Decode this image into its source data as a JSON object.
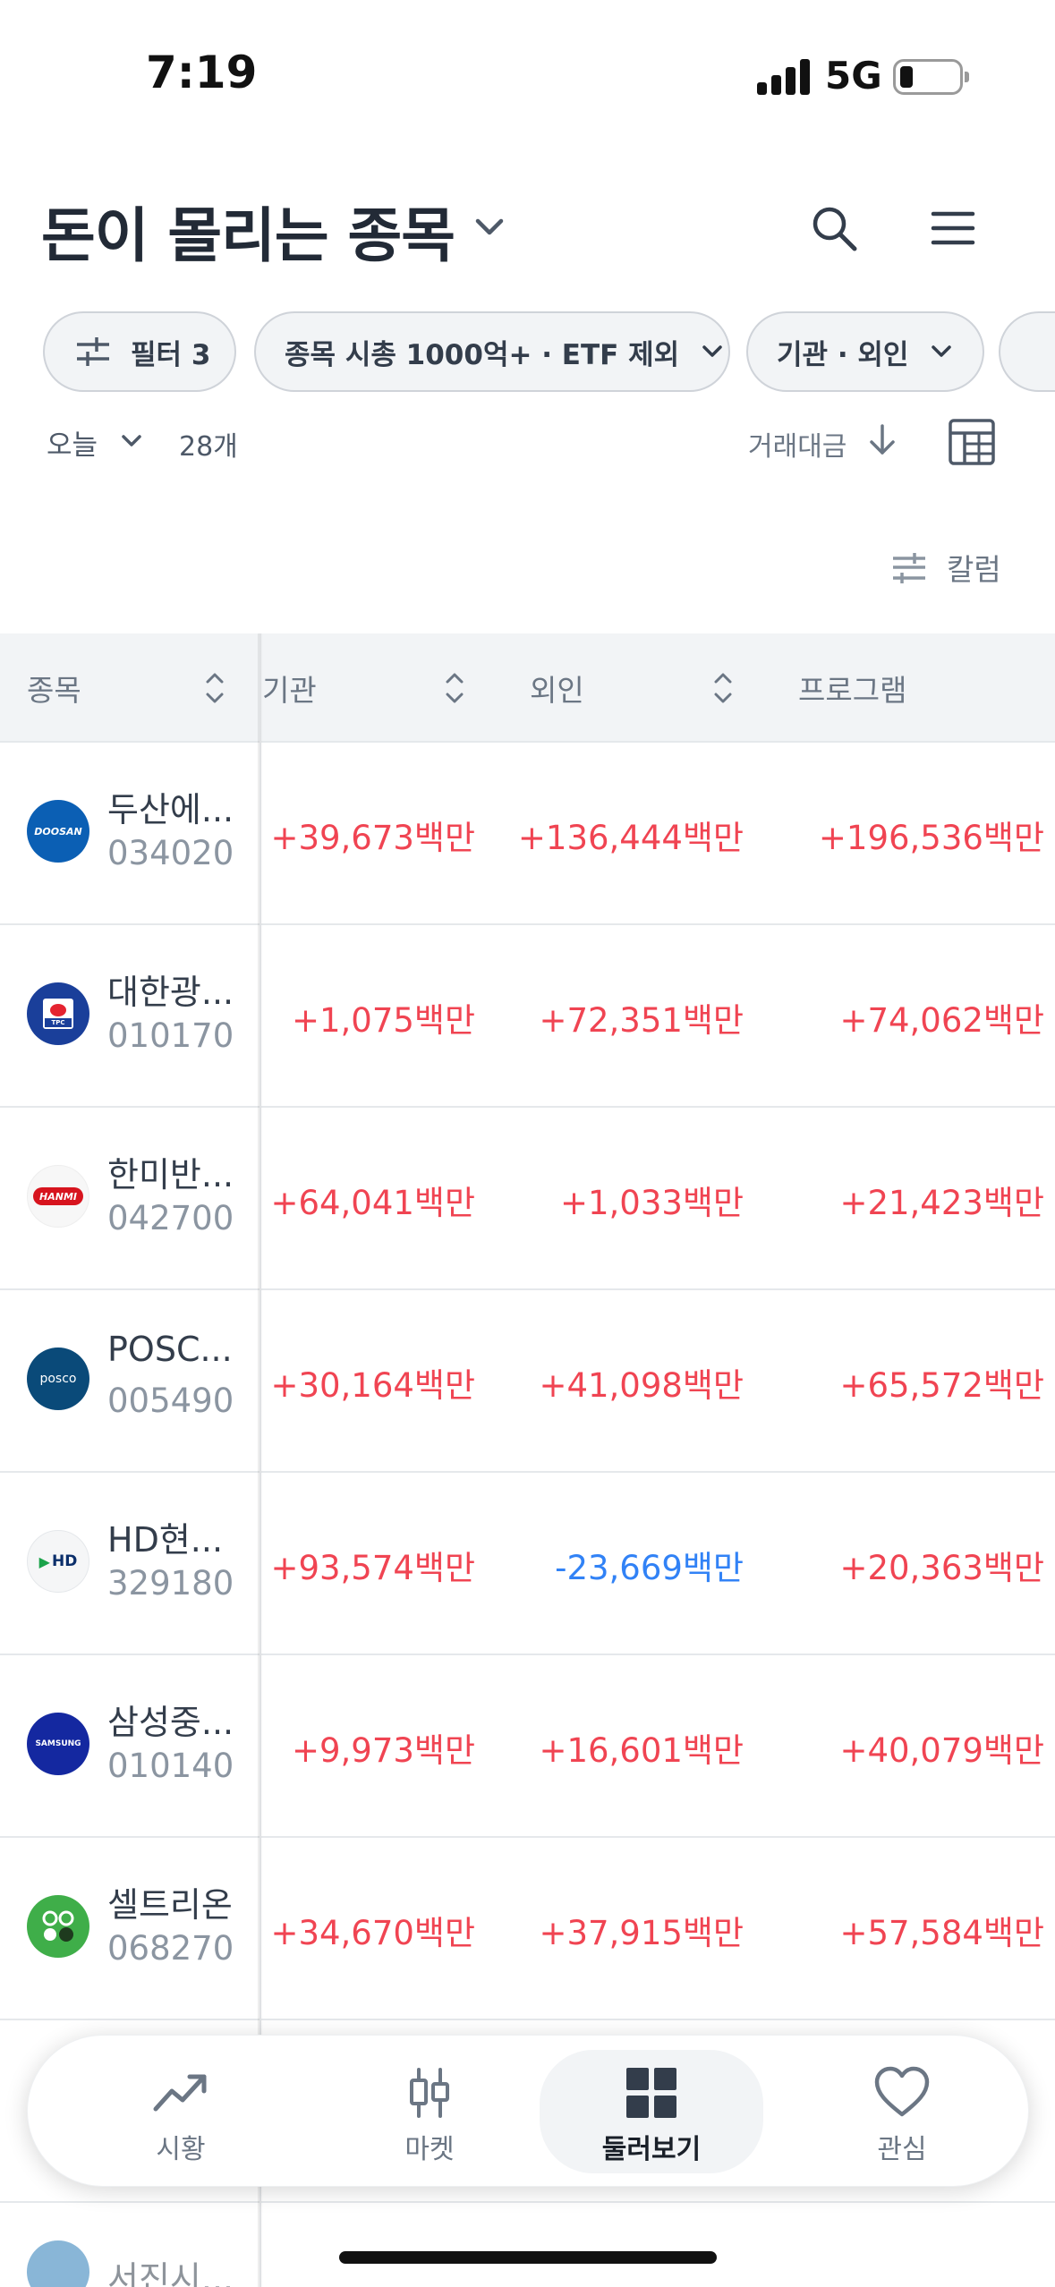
{
  "status": {
    "time": "7:19",
    "network": "5G"
  },
  "header": {
    "title": "돈이 몰리는 종목"
  },
  "filters": {
    "filter_chip": "필터 3",
    "market_chip": "종목 시총 1000억+ · ETF 제외",
    "investor_chip": "기관 · 외인"
  },
  "list": {
    "period": "오늘",
    "count": "28개",
    "sort": "거래대금",
    "column_button": "칼럼"
  },
  "table": {
    "headers": {
      "stock": "종목",
      "institution": "기관",
      "foreign": "외인",
      "program": "프로그램"
    },
    "rows": [
      {
        "name": "두산에...",
        "code": "034020",
        "logo": "DOOSAN",
        "inst": "+39,673백만",
        "foreign": "+136,444백만",
        "program": "+196,536백만",
        "color": "#0b5fb4"
      },
      {
        "name": "대한광...",
        "code": "010170",
        "logo": "TPC",
        "inst": "+1,075백만",
        "foreign": "+72,351백만",
        "program": "+74,062백만",
        "color": "#1a3f9a"
      },
      {
        "name": "한미반...",
        "code": "042700",
        "logo": "HANMI",
        "inst": "+64,041백만",
        "foreign": "+1,033백만",
        "program": "+21,423백만",
        "color": "#f7f7f7"
      },
      {
        "name": "POSC...",
        "code": "005490",
        "logo": "posco",
        "inst": "+30,164백만",
        "foreign": "+41,098백만",
        "program": "+65,572백만",
        "color": "#0a4a79"
      },
      {
        "name": "HD현...",
        "code": "329180",
        "logo": "HD",
        "inst": "+93,574백만",
        "foreign": "-23,669백만",
        "program": "+20,363백만",
        "color": "#f5f6f7"
      },
      {
        "name": "삼성중...",
        "code": "010140",
        "logo": "SAMSUNG",
        "inst": "+9,973백만",
        "foreign": "+16,601백만",
        "program": "+40,079백만",
        "color": "#1428a0"
      },
      {
        "name": "셀트리온",
        "code": "068270",
        "logo": "",
        "inst": "+34,670백만",
        "foreign": "+37,915백만",
        "program": "+57,584백만",
        "color": "#3fae49"
      }
    ],
    "partial_row": {
      "name": "서진시..."
    }
  },
  "nav": {
    "items": [
      {
        "label": "시황",
        "icon": "trend-up-icon"
      },
      {
        "label": "마켓",
        "icon": "candlestick-icon"
      },
      {
        "label": "둘러보기",
        "icon": "grid-icon"
      },
      {
        "label": "관심",
        "icon": "heart-icon"
      }
    ],
    "active": "둘러보기"
  }
}
